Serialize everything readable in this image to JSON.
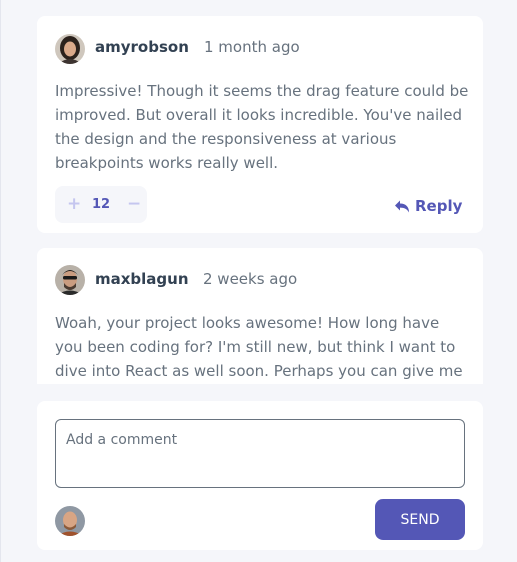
{
  "comments": [
    {
      "username": "amyrobson",
      "avatar_icon": "user-avatar-icon",
      "time": "1 month ago",
      "text": "Impressive! Though it seems the drag feature could be improved. But overall it looks incredible. You've nailed the design and the responsiveness at various breakpoints works really well.",
      "score": "12",
      "upvote_label": "+",
      "downvote_label": "−",
      "reply_label": "Reply"
    },
    {
      "username": "maxblagun",
      "avatar_icon": "user-avatar-icon",
      "time": "2 weeks ago",
      "text": "Woah, your project looks awesome! How long have you been coding for? I'm still new, but think I want to dive into React as well soon. Perhaps you can give me an"
    }
  ],
  "composer": {
    "placeholder": "Add a comment",
    "send_label": "SEND",
    "avatar_icon": "current-user-avatar-icon"
  },
  "colors": {
    "accent": "#5457b6",
    "accent_light": "#c5c6ef",
    "background": "#f5f6fa",
    "text_dark": "#324152",
    "text_muted": "#67727e"
  }
}
